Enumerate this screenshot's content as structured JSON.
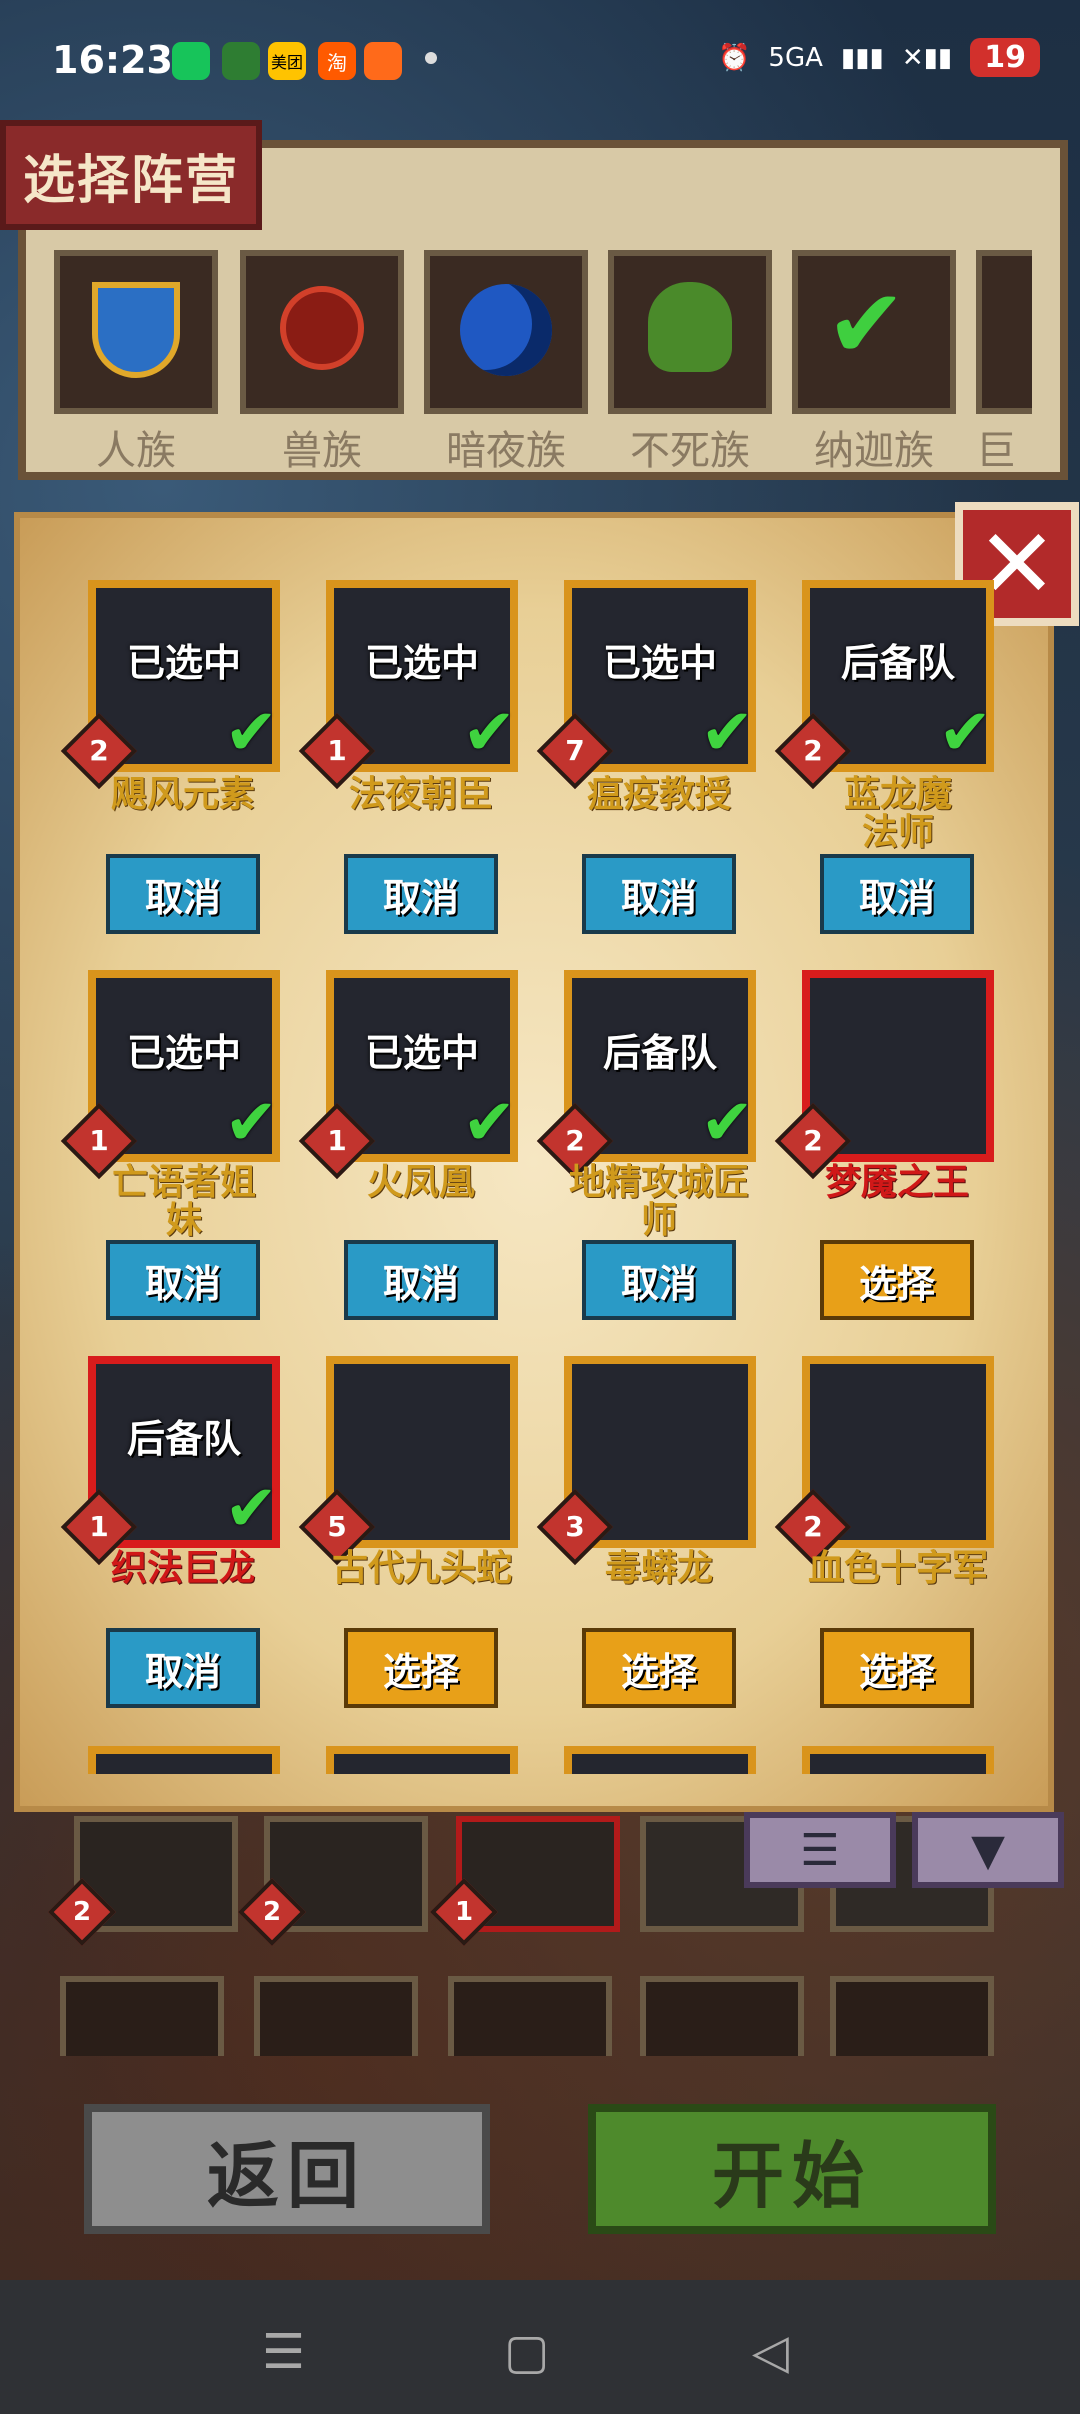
{
  "status_bar": {
    "time": "16:23",
    "app_icons": [
      {
        "name": "wechat-icon",
        "color": "#17c45a"
      },
      {
        "name": "app-green-icon",
        "color": "#2e7d32"
      },
      {
        "name": "meituan-icon",
        "color": "#ffc300",
        "text": "美团"
      },
      {
        "name": "taobao-icon",
        "color": "#ff5a00",
        "text": "淘"
      },
      {
        "name": "app-orange-icon",
        "color": "#ff6a1a"
      }
    ],
    "network": "5GA",
    "battery": "19"
  },
  "camp_panel": {
    "title": "选择阵营",
    "camps": [
      {
        "label": "人族",
        "icon": "shield-wings-icon"
      },
      {
        "label": "兽族",
        "icon": "orc-crest-icon"
      },
      {
        "label": "暗夜族",
        "icon": "moon-icon"
      },
      {
        "label": "不死族",
        "icon": "skull-icon"
      },
      {
        "label": "纳迦族",
        "icon": "naga-check-icon"
      },
      {
        "label": "巨",
        "icon": "partial-camp-icon"
      }
    ]
  },
  "hero_panel": {
    "close_symbol": "✕",
    "heroes": [
      {
        "name": "飓风元素",
        "level": "2",
        "overlay": "已选中",
        "checked": true,
        "action": "取消",
        "name_color": "gold",
        "border": "gold"
      },
      {
        "name": "法夜朝臣",
        "level": "1",
        "overlay": "已选中",
        "checked": true,
        "action": "取消",
        "name_color": "gold",
        "border": "gold"
      },
      {
        "name": "瘟疫教授",
        "level": "7",
        "overlay": "已选中",
        "checked": true,
        "action": "取消",
        "name_color": "gold",
        "border": "gold"
      },
      {
        "name": "蓝龙魔法师",
        "level": "2",
        "overlay": "后备队",
        "checked": true,
        "action": "取消",
        "name_color": "gold",
        "border": "gold"
      },
      {
        "name": "亡语者姐妹",
        "level": "1",
        "overlay": "已选中",
        "checked": true,
        "action": "取消",
        "name_color": "gold",
        "border": "gold"
      },
      {
        "name": "火凤凰",
        "level": "1",
        "overlay": "已选中",
        "checked": true,
        "action": "取消",
        "name_color": "gold",
        "border": "gold"
      },
      {
        "name": "地精攻城匠师",
        "level": "2",
        "overlay": "后备队",
        "checked": true,
        "action": "取消",
        "name_color": "gold",
        "border": "gold"
      },
      {
        "name": "梦魇之王",
        "level": "2",
        "overlay": "",
        "checked": false,
        "action": "选择",
        "name_color": "red",
        "border": "red"
      },
      {
        "name": "织法巨龙",
        "level": "1",
        "overlay": "后备队",
        "checked": true,
        "action": "取消",
        "name_color": "red",
        "border": "red"
      },
      {
        "name": "古代九头蛇",
        "level": "5",
        "overlay": "",
        "checked": false,
        "action": "选择",
        "name_color": "gold",
        "border": "gold"
      },
      {
        "name": "毒蟒龙",
        "level": "3",
        "overlay": "",
        "checked": false,
        "action": "选择",
        "name_color": "gold",
        "border": "gold"
      },
      {
        "name": "血色十字军",
        "level": "2",
        "overlay": "",
        "checked": false,
        "action": "选择",
        "name_color": "gold",
        "border": "gold"
      }
    ]
  },
  "team": {
    "slots": [
      {
        "level": "2",
        "filled": true
      },
      {
        "level": "2",
        "filled": true
      },
      {
        "level": "1",
        "filled": true
      },
      {
        "level": "",
        "filled": false
      },
      {
        "level": "",
        "filled": false
      }
    ],
    "list_button": "☰",
    "filter_button": "▼"
  },
  "buttons": {
    "back": "返回",
    "start": "开始"
  },
  "nav_bar": {
    "menu": "☰",
    "home": "▢",
    "back": "◁"
  }
}
